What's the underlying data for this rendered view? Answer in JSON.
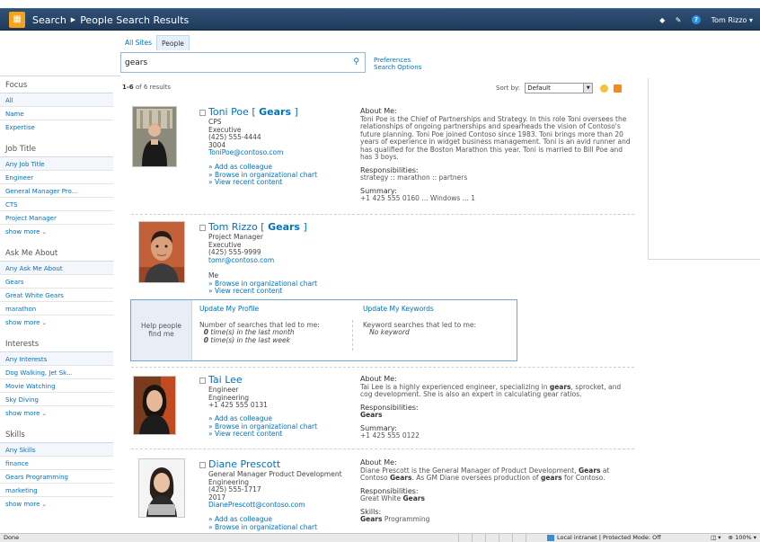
{
  "header": {
    "breadcrumb": [
      "Search",
      "People Search Results"
    ],
    "user": "Tom Rizzo"
  },
  "scopes": [
    "All Sites",
    "People"
  ],
  "search": {
    "value": "gears"
  },
  "prefs": {
    "preferences": "Preferences",
    "options": "Search Options"
  },
  "sidebar": {
    "groups": [
      {
        "title": "Focus",
        "items": [
          "All",
          "Name",
          "Expertise"
        ]
      },
      {
        "title": "Job Title",
        "items": [
          "Any Job Title",
          "Engineer",
          "General Manager Pro...",
          "CTS",
          "Project Manager",
          "show more"
        ]
      },
      {
        "title": "Ask Me About",
        "items": [
          "Any Ask Me About",
          "Gears",
          "Great White Gears",
          "marathon",
          "show more"
        ]
      },
      {
        "title": "Interests",
        "items": [
          "Any Interests",
          "Dog Walking, Jet Sk...",
          "Movie Watching",
          "Sky Diving",
          "show more"
        ]
      },
      {
        "title": "Skills",
        "items": [
          "Any Skills",
          "finance",
          "Gears Programming",
          "marketing",
          "show more"
        ]
      }
    ]
  },
  "results": {
    "count_bold": "1-6",
    "count_rest": " of 6 results",
    "sort_label": "Sort by:",
    "sort_value": "Default"
  },
  "people": {
    "toni": {
      "name": "Toni Poe",
      "keyword": "Gears",
      "lines": [
        "CPS",
        "Executive",
        "(425) 555-4444",
        "3004"
      ],
      "email": "ToniPoe@contoso.com",
      "links": [
        "» Add as colleague",
        "» Browse in organizational chart",
        "» View recent content"
      ],
      "about_title": "About Me:",
      "about": "Toni Poe is the Chief of Partnerships and Strategy. In this role Toni oversees the relationships of ongoing partnerships and spearheads the vision of Contoso's future planning. Toni Poe joined Contoso since 1983. Toni brings more than 20 years of experience in widget business management. Toni is an avid runner and has qualified for the Boston Marathon this year. Toni is married to Bill Poe and has 3 boys.",
      "resp_title": "Responsibilities:",
      "resp": "strategy :: marathon :: partners",
      "summary_title": "Summary:",
      "summary": "+1 425 555 0160 ... Windows ... 1"
    },
    "tom": {
      "name": "Tom Rizzo",
      "keyword": "Gears",
      "lines": [
        "Project Manager",
        "Executive",
        "(425) 555-9999"
      ],
      "email": "tomr@contoso.com",
      "me": "Me",
      "links": [
        "» Browse in organizational chart",
        "» View recent content"
      ]
    },
    "tai": {
      "name": "Tai Lee",
      "lines": [
        "Engineer",
        "Engineering",
        "+1 425 555 0131"
      ],
      "links": [
        "» Add as colleague",
        "» Browse in organizational chart",
        "» View recent content"
      ],
      "about_title": "About Me:",
      "about_a": "Tai Lee is a highly experienced engineer, specializing in ",
      "about_b": "gears",
      "about_c": ", sprocket, and cog development. She is also an expert in calculating gear ratios.",
      "resp_title": "Responsibilities:",
      "resp": "Gears",
      "summary_title": "Summary:",
      "summary": "+1 425 555 0122"
    },
    "diane": {
      "name": "Diane Prescott",
      "lines": [
        "General Manager Product Development",
        "Engineering",
        "(425) 555-1717",
        "2017"
      ],
      "email": "DianePrescott@contoso.com",
      "links": [
        "» Add as colleague",
        "» Browse in organizational chart"
      ],
      "about_title": "About Me:",
      "about_a": "Diane Prescott is the General Manager of Product Development, ",
      "about_b": "Gears",
      "about_c": " at Contoso ",
      "about_d": "Gears",
      "about_e": ". As GM Diane oversees production of ",
      "about_f": "gears",
      "about_g": " for Contoso.",
      "resp_title": "Responsibilities:",
      "resp_a": "Great White ",
      "resp_b": "Gears",
      "skills_title": "Skills:",
      "skills_a": "Gears",
      "skills_b": " Programming"
    }
  },
  "help": {
    "left": [
      "Help people",
      "find me"
    ],
    "profile_title": "Update My Profile",
    "profile_text": "Number of searches that led to me:",
    "profile_n1": "0",
    "profile_l1": " time(s) in the last month",
    "profile_n2": "0",
    "profile_l2": " time(s) in the last week",
    "kw_title": "Update My Keywords",
    "kw_text": "Keyword searches that led to me:",
    "kw_none": "No keyword"
  },
  "status": {
    "left": "Done",
    "zone": "Local intranet | Protected Mode: Off",
    "zoom": "100%"
  },
  "colors": {
    "topbar": "#24466b",
    "link": "#0072bc",
    "logo": "#f6a21a"
  }
}
